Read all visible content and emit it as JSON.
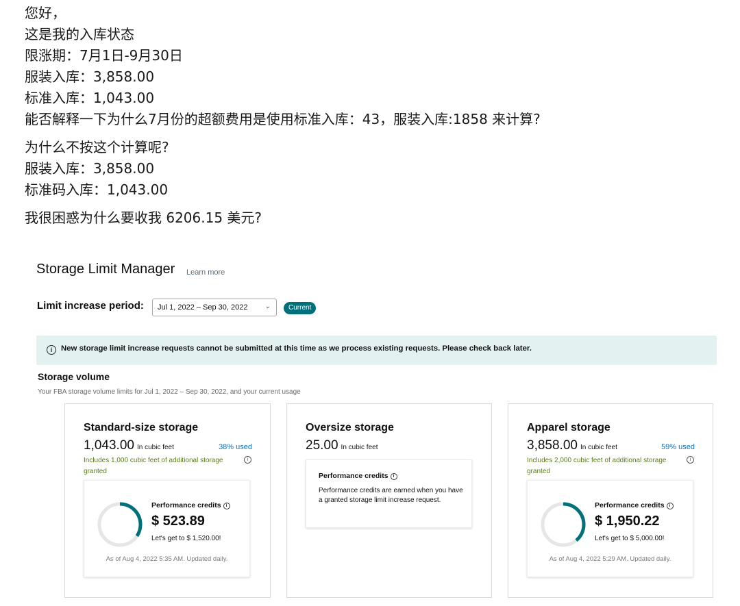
{
  "message": {
    "lines1": [
      "您好，",
      "这是我的入库状态",
      "限涨期：7月1日-9月30日",
      "服装入库：3,858.00",
      "标准入库：1,043.00",
      "能否解释一下为什么7月份的超额费用是使用标准入库：43，服装入库:1858 来计算?"
    ],
    "lines2": [
      "为什么不按这个计算呢?",
      "服装入库：3,858.00",
      "标准码入库：1,043.00"
    ],
    "lines3": [
      "我很困惑为什么要收我 6206.15 美元?"
    ]
  },
  "slm": {
    "title": "Storage Limit Manager",
    "learn_more": "Learn more",
    "period_label": "Limit increase period:",
    "period_value": "Jul 1, 2022 – Sep 30, 2022",
    "current_badge": "Current",
    "alert_text": "New storage limit increase requests cannot be submitted at this time as we process existing requests. Please check back later.",
    "volume_title": "Storage volume",
    "volume_subtitle": "Your FBA storage volume limits for Jul 1, 2022 – Sep 30, 2022, and your current usage"
  },
  "cards": {
    "standard": {
      "title": "Standard-size storage",
      "amount": "1,043.00",
      "unit": "In cubic feet",
      "used": "38% used",
      "includes": "Includes 1,000 cubic feet of additional storage granted",
      "credits_label": "Performance credits",
      "credits_amount": "$ 523.89",
      "credits_goal": "Let's get to $ 1,520.00!",
      "as_of": "As of Aug 4, 2022 5:35 AM. Updated daily.",
      "progress": 0.344
    },
    "oversize": {
      "title": "Oversize storage",
      "amount": "25.00",
      "unit": "In cubic feet",
      "credits_label": "Performance credits",
      "credits_text": "Performance credits are earned when you have a granted storage limit increase request."
    },
    "apparel": {
      "title": "Apparel storage",
      "amount": "3,858.00",
      "unit": "In cubic feet",
      "used": "59% used",
      "includes": "Includes 2,000 cubic feet of additional storage granted",
      "credits_label": "Performance credits",
      "credits_amount": "$ 1,950.22",
      "credits_goal": "Let's get to $ 5,000.00!",
      "as_of": "As of Aug 4, 2022 5:29 AM. Updated daily.",
      "progress": 0.39
    }
  },
  "colors": {
    "accent": "#00707b",
    "ring_track": "#e6e6e6",
    "alert_bg": "#e3f2f1",
    "link": "#0a6ebd",
    "includes_text": "#5b7a1f"
  }
}
